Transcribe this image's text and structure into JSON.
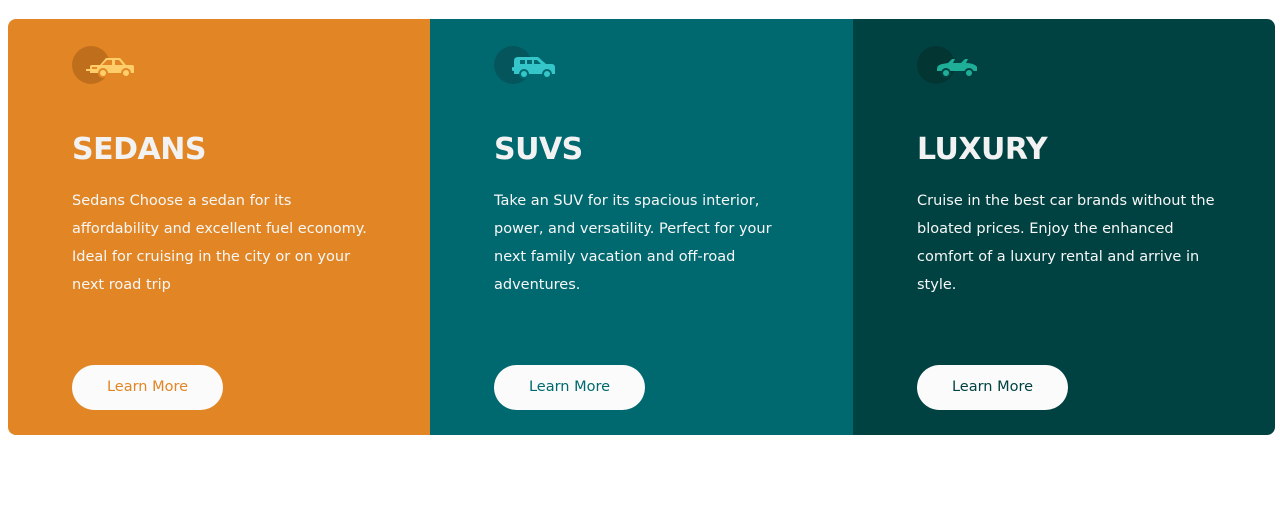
{
  "cards": [
    {
      "id": "sedans",
      "title": "SEDANS",
      "text": "Sedans Choose a sedan for its affordability and excellent fuel economy. Ideal for cruising in the city or on your next road trip",
      "button_label": "Learn More",
      "icon": "sedan-car-icon",
      "background": "#e28625",
      "icon_color": "#ffce6b"
    },
    {
      "id": "suvs",
      "title": "SUVS",
      "text": "Take an SUV for its spacious interior, power, and versatility. Perfect for your next family vacation and off-road adventures.",
      "button_label": "Learn More",
      "icon": "suv-car-icon",
      "background": "#006970",
      "icon_color": "#34c6c8"
    },
    {
      "id": "luxury",
      "title": "LUXURY",
      "text": "Cruise in the best car brands without the bloated prices. Enjoy the enhanced comfort of a luxury rental and arrive in style.",
      "button_label": "Learn More",
      "icon": "luxury-car-icon",
      "background": "#004241",
      "icon_color": "#1fae97"
    }
  ]
}
